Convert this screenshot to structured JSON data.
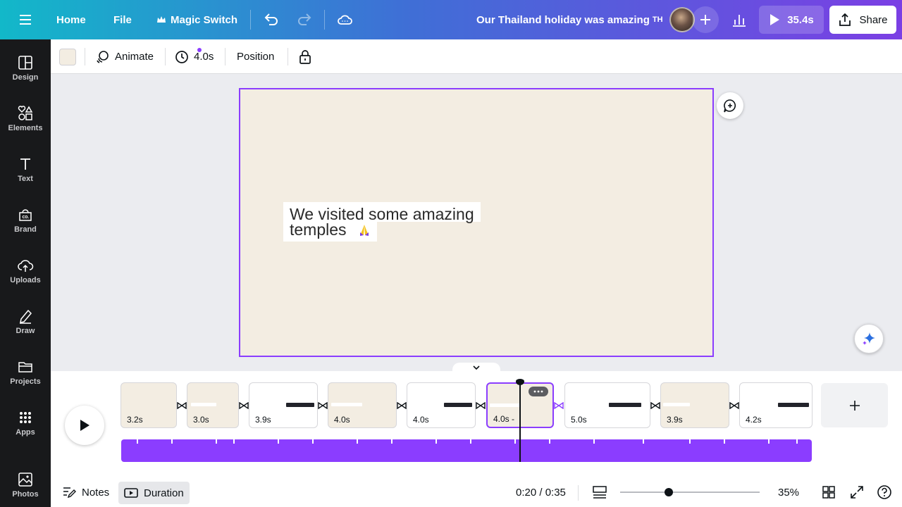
{
  "topbar": {
    "home": "Home",
    "file": "File",
    "magic_switch": "Magic Switch",
    "doc_title": "Our Thailand holiday was amazing",
    "doc_title_suffix": "TH",
    "play_duration": "35.4s",
    "share": "Share"
  },
  "sidebar": {
    "items": [
      {
        "label": "Design",
        "icon": "layout-icon"
      },
      {
        "label": "Elements",
        "icon": "shapes-icon"
      },
      {
        "label": "Text",
        "icon": "text-icon"
      },
      {
        "label": "Brand",
        "icon": "brand-icon"
      },
      {
        "label": "Uploads",
        "icon": "cloud-upload-icon"
      },
      {
        "label": "Draw",
        "icon": "pen-icon"
      },
      {
        "label": "Projects",
        "icon": "folder-icon"
      },
      {
        "label": "Apps",
        "icon": "grid-icon"
      },
      {
        "label": "Photos",
        "icon": "image-icon"
      }
    ]
  },
  "toolbar": {
    "animate": "Animate",
    "duration": "4.0s",
    "position": "Position"
  },
  "canvas": {
    "text_line1": "We visited some amazing",
    "text_line2": "temples",
    "background": "#f3ede2"
  },
  "timeline": {
    "pages": [
      {
        "duration": "3.2s"
      },
      {
        "duration": "3.0s"
      },
      {
        "duration": "3.9s"
      },
      {
        "duration": "4.0s"
      },
      {
        "duration": "4.0s"
      },
      {
        "duration": "4.0s -"
      },
      {
        "duration": "5.0s"
      },
      {
        "duration": "3.9s"
      },
      {
        "duration": "4.2s"
      }
    ],
    "time": "0:20 / 0:35",
    "zoom": "35%",
    "notes": "Notes",
    "duration_btn": "Duration",
    "zoom_level": 0.35
  },
  "colors": {
    "accent": "#8b3dff",
    "sidebar": "#18191b"
  }
}
